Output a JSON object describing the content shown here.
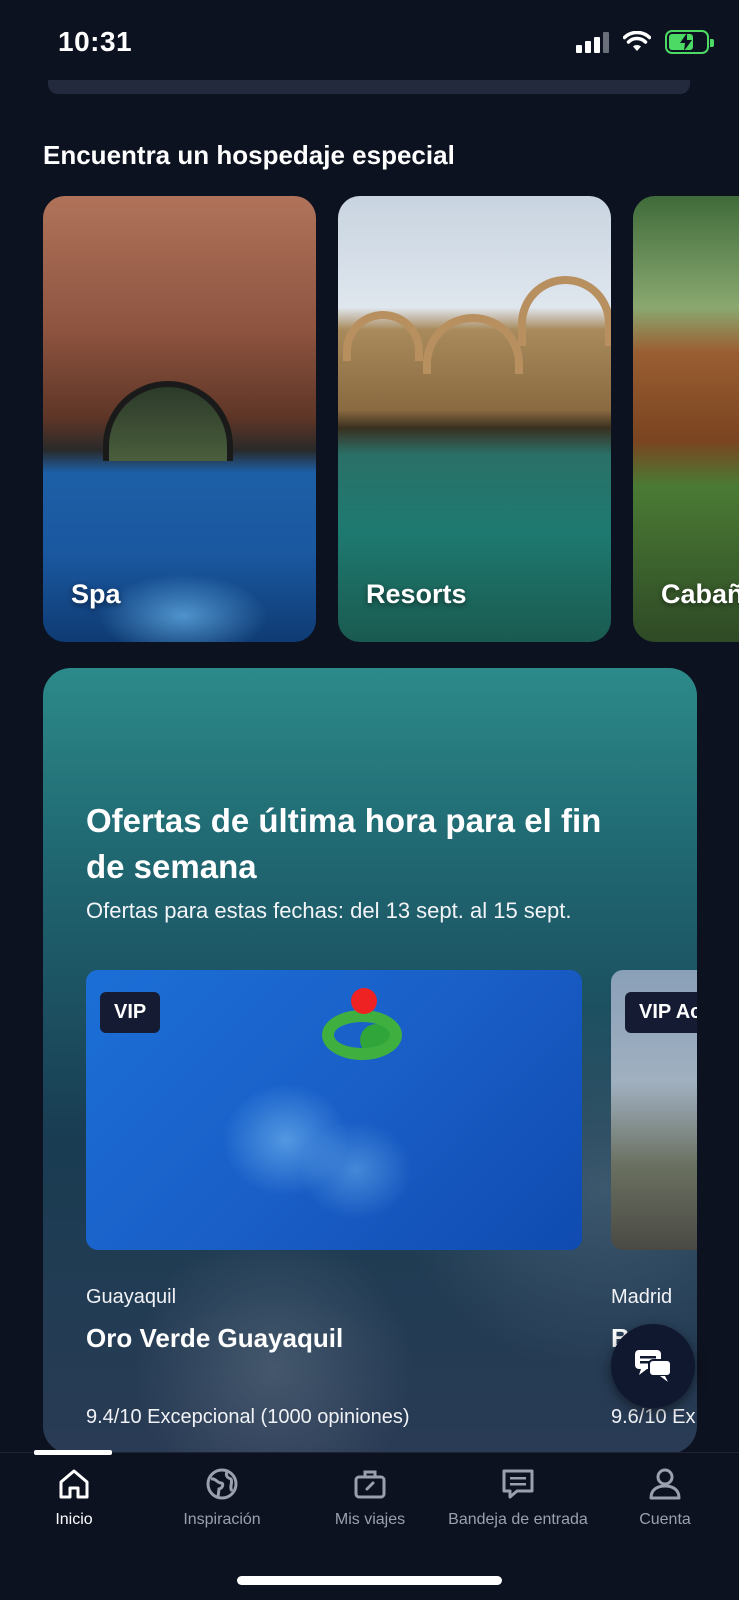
{
  "status_bar": {
    "time": "10:31"
  },
  "special_stays": {
    "title": "Encuentra un hospedaje especial",
    "cards": [
      {
        "label": "Spa"
      },
      {
        "label": "Resorts"
      },
      {
        "label": "Cabañ"
      }
    ]
  },
  "last_minute": {
    "title": "Ofertas de última hora para el fin de semana",
    "subtitle": "Ofertas para estas fechas: del 13 sept. al 15 sept.",
    "deals": [
      {
        "badge": "VIP",
        "city": "Guayaquil",
        "name": "Oro Verde Guayaquil",
        "rating": "9.4/10 Excepcional (1000 opiniones)"
      },
      {
        "badge": "VIP Ac",
        "city": "Madrid",
        "name": "B",
        "rating": "9.6/10 Ex"
      }
    ]
  },
  "nav": {
    "items": [
      {
        "label": "Inicio",
        "icon": "home-icon"
      },
      {
        "label": "Inspiración",
        "icon": "globe-icon"
      },
      {
        "label": "Mis viajes",
        "icon": "suitcase-icon"
      },
      {
        "label": "Bandeja de entrada",
        "icon": "inbox-icon"
      },
      {
        "label": "Cuenta",
        "icon": "account-icon"
      }
    ]
  }
}
